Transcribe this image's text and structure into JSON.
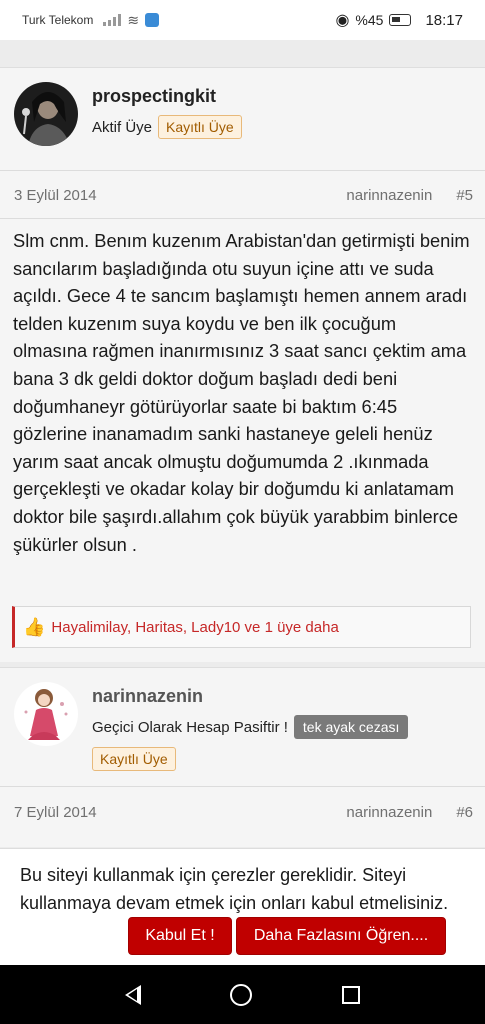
{
  "status_bar": {
    "carrier": "Turk Telekom",
    "battery": "%45",
    "time": "18:17"
  },
  "posts": [
    {
      "author": "prospectingkit",
      "role": "Aktif Üye",
      "badge": "Kayıtlı Üye",
      "date": "3 Eylül 2014",
      "poster": "narinnazenin",
      "number": "#5",
      "message": "Slm cnm. Benım kuzenım Arabistan'dan getirmişti benim sancılarım başladığında otu suyun içine attı ve suda açıldı. Gece 4 te sancım başlamıştı hemen annem aradı telden kuzenım suya koydu ve ben ilk çocuğum olmasına rağmen inanırmısınız 3 saat sancı çektim ama bana 3 dk geldi doktor doğum başladı dedi beni doğumhaneyr götürüyorlar saate bi baktım 6:45 gözlerine inanamadım sanki hastaneye geleli henüz yarım saat ancak olmuştu doğumumda 2 .ıkınmada gerçekleşti ve okadar kolay bir doğumdu ki anlatamam doktor bile şaşırdı.allahım çok büyük yarabbim binlerce şükürler olsun .",
      "likes": "Hayalimilay, Haritas, Lady10 ve 1 üye daha"
    },
    {
      "author": "narinnazenin",
      "role": "Geçici Olarak Hesap Pasiftir !",
      "penalty": "tek ayak cezası",
      "badge": "Kayıtlı Üye",
      "date": "7 Eylül 2014",
      "poster": "narinnazenin",
      "number": "#6"
    }
  ],
  "cookie": {
    "text": "Bu siteyi kullanmak için çerezler gereklidir. Siteyi kullanmaya devam etmek için onları kabul etmelisiniz.",
    "accept": "Kabul Et !",
    "learn_more": "Daha Fazlasını Öğren...."
  },
  "colors": {
    "accent": "#c00000",
    "badge_border": "#e8b97a",
    "likes_text": "#c62828"
  }
}
